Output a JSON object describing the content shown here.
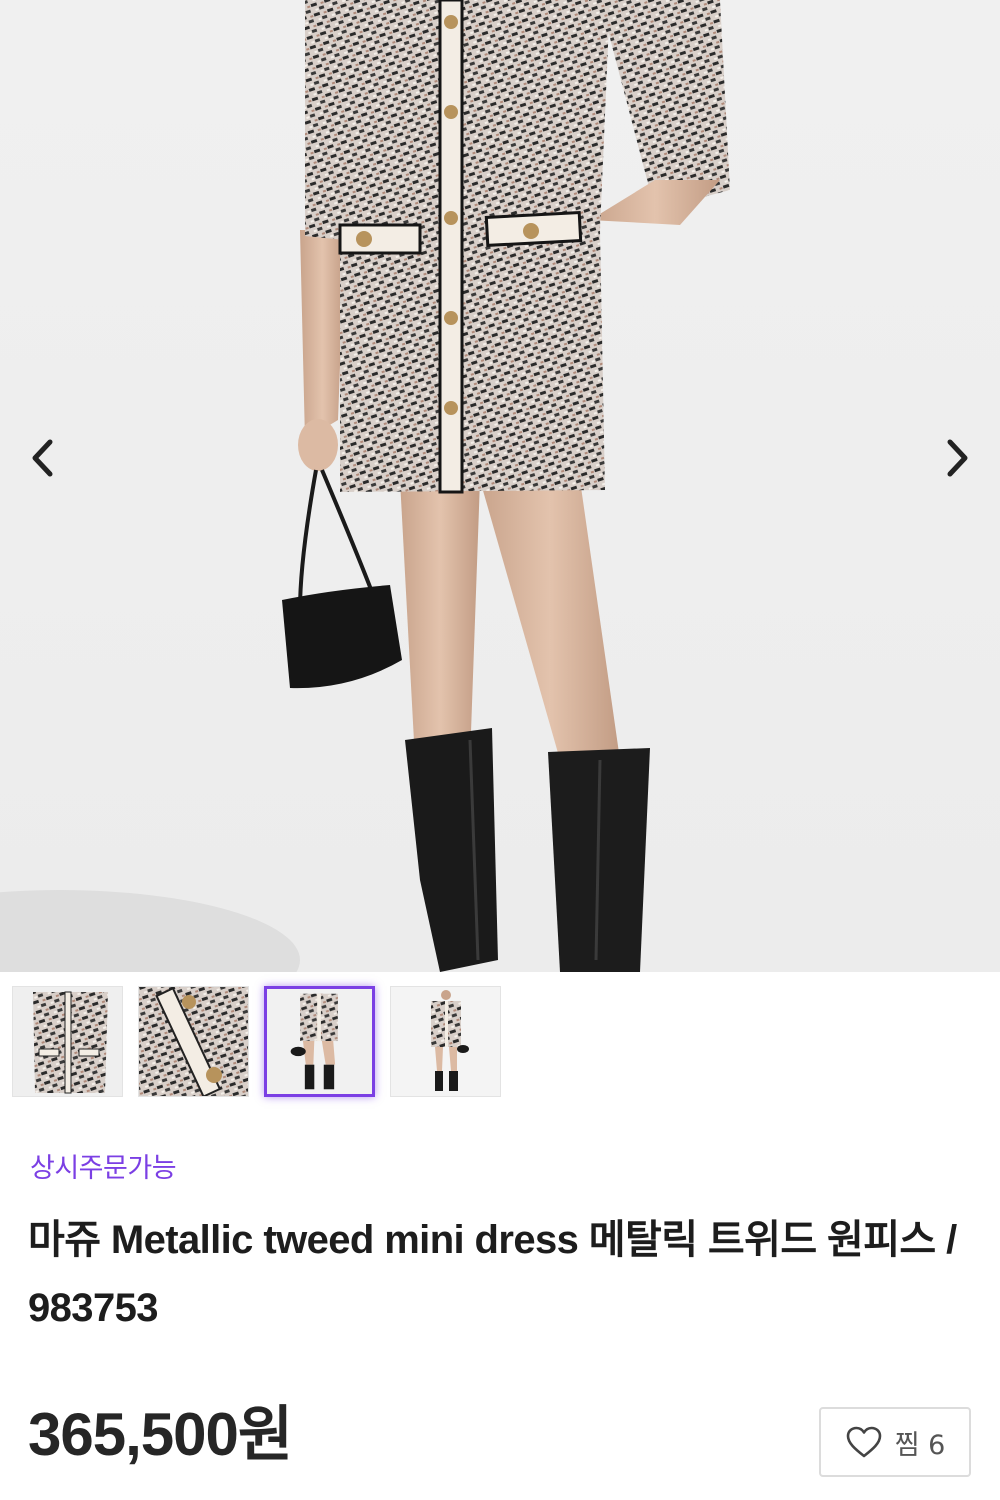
{
  "gallery": {
    "prev_icon": "chevron-left-icon",
    "next_icon": "chevron-right-icon",
    "thumbnails": [
      {
        "name": "dress-front-closeup"
      },
      {
        "name": "fabric-detail"
      },
      {
        "name": "model-with-boots",
        "active": true
      },
      {
        "name": "model-full-length"
      }
    ],
    "accent_color": "#7b3fe4"
  },
  "product": {
    "availability": "상시주문가능",
    "title": "마쥬 Metallic tweed mini dress 메탈릭 트위드 원피스 / 983753",
    "price": "365,500원"
  },
  "wishlist": {
    "icon": "heart-outline-icon",
    "label": "찜 6"
  }
}
